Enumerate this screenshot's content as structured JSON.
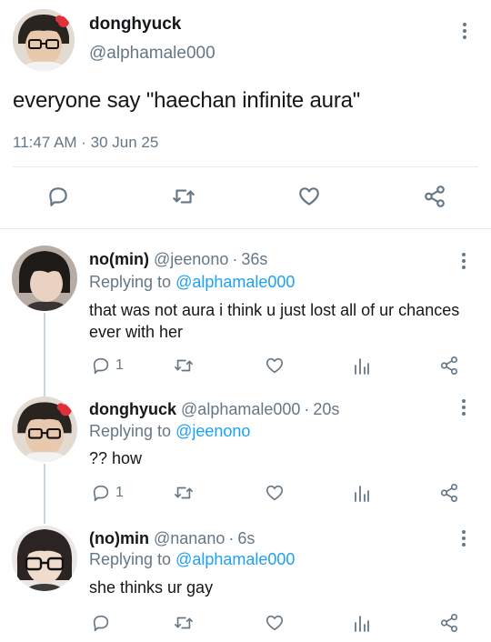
{
  "main_tweet": {
    "display_name": "donghyuck",
    "handle": "@alphamale000",
    "text": "everyone say \"haechan infinite aura\"",
    "timestamp": "11:47 AM · 30 Jun 25",
    "actions": [
      "reply-icon",
      "retweet-icon",
      "like-icon",
      "share-icon"
    ]
  },
  "replies": [
    {
      "display_name": "no(min)",
      "handle": "@jeenono",
      "separator": "·",
      "time": "36s",
      "replying_prefix": "Replying to",
      "replying_to": "@alphamale000",
      "text": "that was not aura i think u just lost all of ur chances ever with her",
      "reply_count": "1"
    },
    {
      "display_name": "donghyuck",
      "handle": "@alphamale000",
      "separator": "·",
      "time": "20s",
      "replying_prefix": "Replying to",
      "replying_to": "@jeenono",
      "text": "?? how",
      "reply_count": "1"
    },
    {
      "display_name": "(no)min",
      "handle": "@nanano",
      "separator": "·",
      "time": "6s",
      "replying_prefix": "Replying to",
      "replying_to": "@alphamale000",
      "text": "she thinks ur gay",
      "reply_count": ""
    }
  ],
  "colors": {
    "text": "#14171a",
    "secondary": "#657786",
    "link": "#1da1f2",
    "divider": "#e6ecf0"
  }
}
